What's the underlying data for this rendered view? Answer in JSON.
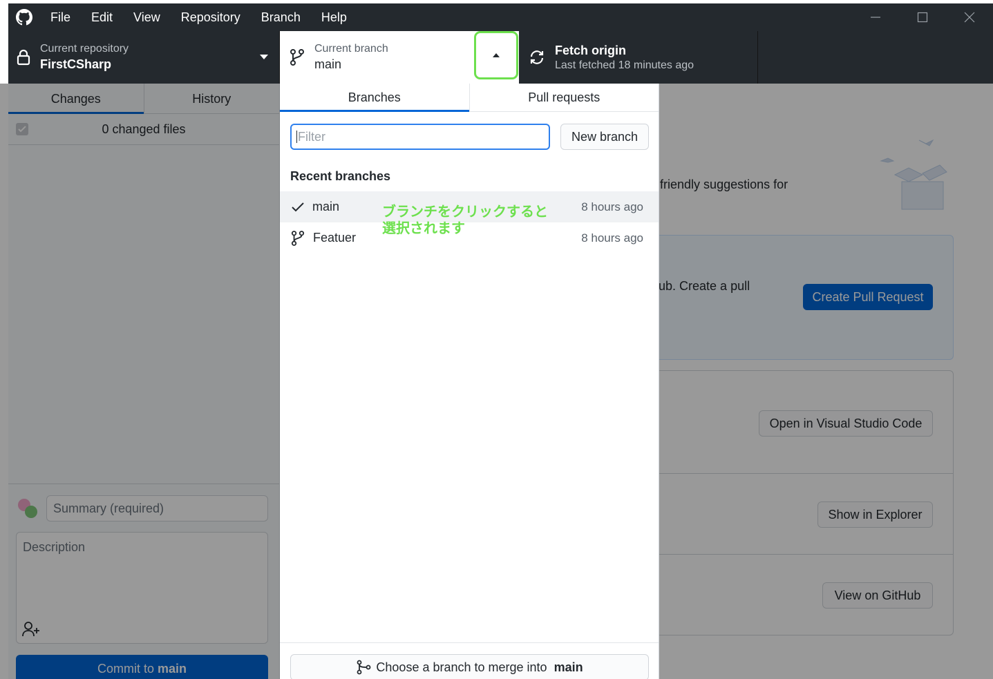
{
  "menu": [
    "File",
    "Edit",
    "View",
    "Repository",
    "Branch",
    "Help"
  ],
  "toolbar": {
    "repo_label": "Current repository",
    "repo_name": "FirstCSharp",
    "branch_label": "Current branch",
    "branch_name": "main",
    "fetch_title": "Fetch origin",
    "fetch_subtitle": "Last fetched 18 minutes ago"
  },
  "sidebar": {
    "tabs": [
      "Changes",
      "History"
    ],
    "changed_files": "0 changed files",
    "summary_placeholder": "Summary (required)",
    "description_placeholder": "Description",
    "commit_prefix": "Commit to ",
    "commit_branch": "main"
  },
  "main": {
    "suggest_text": "are some friendly suggestions for",
    "pr_text": "ub. Create a pull",
    "create_pr": "Create Pull Request",
    "open_vscode": "Open in Visual Studio Code",
    "show_explorer": "Show in Explorer",
    "view_github": "View on GitHub"
  },
  "dropdown": {
    "tabs": [
      "Branches",
      "Pull requests"
    ],
    "filter_placeholder": "Filter",
    "new_branch": "New branch",
    "recent_header": "Recent branches",
    "branches": [
      {
        "name": "main",
        "time": "8 hours ago",
        "current": true
      },
      {
        "name": "Featuer",
        "time": "8 hours ago",
        "current": false
      }
    ],
    "annotation_line1": "ブランチをクリックすると",
    "annotation_line2": "選択されます",
    "merge_prefix": "Choose a branch to merge into ",
    "merge_branch": "main"
  },
  "colors": {
    "toolbar_bg": "#24292e",
    "accent_blue": "#0366d6",
    "highlight_green": "#6de04e"
  }
}
